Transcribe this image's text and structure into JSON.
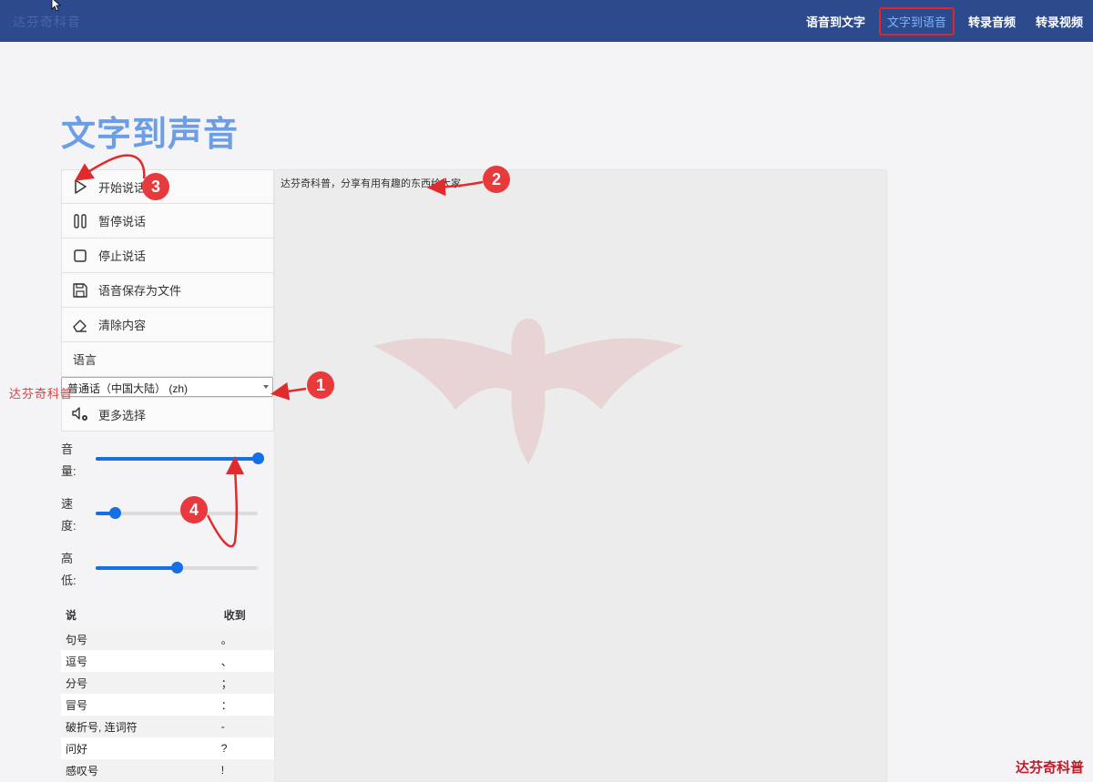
{
  "topbar": {
    "watermark": "达芬奇科音",
    "nav": [
      {
        "label": "语音到文字"
      },
      {
        "label": "文字到语音",
        "active": true
      },
      {
        "label": "转录音频"
      },
      {
        "label": "转录视频"
      }
    ]
  },
  "page": {
    "title": "文字到声音"
  },
  "actions": {
    "start": "开始说话",
    "pause": "暂停说话",
    "stop": "停止说话",
    "save": "语音保存为文件",
    "clear": "清除内容",
    "more": "更多选择"
  },
  "language": {
    "label": "语言",
    "selected": "普通话（中国大陆） (zh)"
  },
  "sliders": {
    "volume": {
      "label_top": "音",
      "label_bottom": "量:",
      "value": 1.0
    },
    "rate": {
      "label_top": "速",
      "label_bottom": "度:",
      "value": 0.12
    },
    "pitch": {
      "label_top": "高",
      "label_bottom": "低:",
      "value": 0.5
    }
  },
  "punctuation": {
    "headers": [
      "说",
      "收到"
    ],
    "rows": [
      [
        "句号",
        "。"
      ],
      [
        "逗号",
        "、"
      ],
      [
        "分号",
        "；"
      ],
      [
        "冒号",
        "："
      ],
      [
        "破折号, 连词符",
        "-"
      ],
      [
        "问好",
        "?"
      ],
      [
        "感叹号",
        "!"
      ]
    ]
  },
  "editor": {
    "text": "达芬奇科普，分享有用有趣的东西给大家"
  },
  "annotations": {
    "n1": "1",
    "n2": "2",
    "n3": "3",
    "n4": "4",
    "side_watermark": "达芬奇科普",
    "corner_watermark": "达芬奇科普"
  },
  "colors": {
    "nav_bg": "#2c4a8c",
    "accent": "#1570e6",
    "title": "#6c9ee8",
    "annotation": "#e8393c"
  }
}
